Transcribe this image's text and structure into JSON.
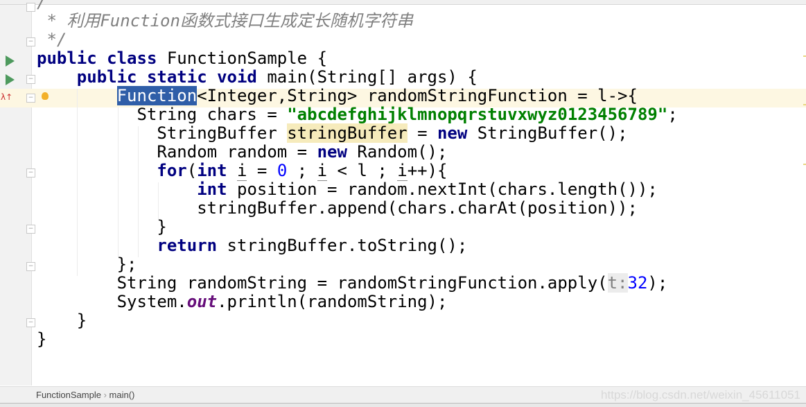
{
  "editor": {
    "lines": [
      [
        [
          "/",
          "cmt"
        ]
      ],
      [
        [
          " * 利用Function函数式接口生成定长随机字符串",
          "cmt"
        ]
      ],
      [
        [
          " */",
          "cmt"
        ]
      ],
      [
        [
          "public class",
          "kw"
        ],
        [
          " FunctionSample {",
          ""
        ]
      ],
      [
        [
          "    ",
          ""
        ],
        [
          "public static void",
          "kw"
        ],
        [
          " main(String[] args) {",
          ""
        ]
      ],
      [
        [
          "        ",
          ""
        ],
        [
          "Function",
          "sel"
        ],
        [
          "<Integer,String> randomStringFunction = l->{",
          ""
        ]
      ],
      [
        [
          "          String chars = ",
          ""
        ],
        [
          "\"abcdefghijklmnopqrstuvxwyz0123456789\"",
          "str"
        ],
        [
          ";",
          ""
        ]
      ],
      [
        [
          "            StringBuffer ",
          ""
        ],
        [
          "stringBuffer",
          "hl"
        ],
        [
          " = ",
          ""
        ],
        [
          "new",
          "kw"
        ],
        [
          " StringBuffer();",
          ""
        ]
      ],
      [
        [
          "            Random random = ",
          ""
        ],
        [
          "new",
          "kw"
        ],
        [
          " Random();",
          ""
        ]
      ],
      [
        [
          "            ",
          ""
        ],
        [
          "for",
          "kw"
        ],
        [
          "(",
          ""
        ],
        [
          "int",
          "kw"
        ],
        [
          " ",
          ""
        ],
        [
          "i",
          "under"
        ],
        [
          " = ",
          ""
        ],
        [
          "0",
          "num"
        ],
        [
          " ; ",
          ""
        ],
        [
          "i",
          "under"
        ],
        [
          " < l ; ",
          ""
        ],
        [
          "i",
          "under"
        ],
        [
          "++){",
          ""
        ]
      ],
      [
        [
          "                ",
          ""
        ],
        [
          "int",
          "kw"
        ],
        [
          " position = random.nextInt(chars.length());",
          ""
        ]
      ],
      [
        [
          "                stringBuffer.append(chars.charAt(position));",
          ""
        ]
      ],
      [
        [
          "            }",
          ""
        ]
      ],
      [
        [
          "            ",
          ""
        ],
        [
          "return",
          "kw"
        ],
        [
          " stringBuffer.toString();",
          ""
        ]
      ],
      [
        [
          "        };",
          ""
        ]
      ],
      [
        [
          "        String randomString = randomStringFunction.apply(",
          ""
        ],
        [
          "t:",
          "hint"
        ],
        [
          "32",
          "num"
        ],
        [
          ");",
          ""
        ]
      ],
      [
        [
          "        System.",
          ""
        ],
        [
          "out",
          "field"
        ],
        [
          ".println(randomString);",
          ""
        ]
      ],
      [
        [
          "    }",
          ""
        ]
      ],
      [
        [
          "}",
          ""
        ]
      ]
    ]
  },
  "gutter": {
    "run_icons": [
      "run-class",
      "run-main"
    ],
    "lambda_marker": "λ↑"
  },
  "statusbar": {
    "breadcrumb": [
      "FunctionSample",
      "main()"
    ],
    "separator": "›",
    "watermark": "https://blog.csdn.net/weixin_45611051"
  },
  "colors": {
    "keyword": "#000080",
    "string": "#008000",
    "comment": "#808080",
    "number": "#0000ff",
    "selection": "#2f5ea8",
    "current_line": "#fdf7e2"
  }
}
